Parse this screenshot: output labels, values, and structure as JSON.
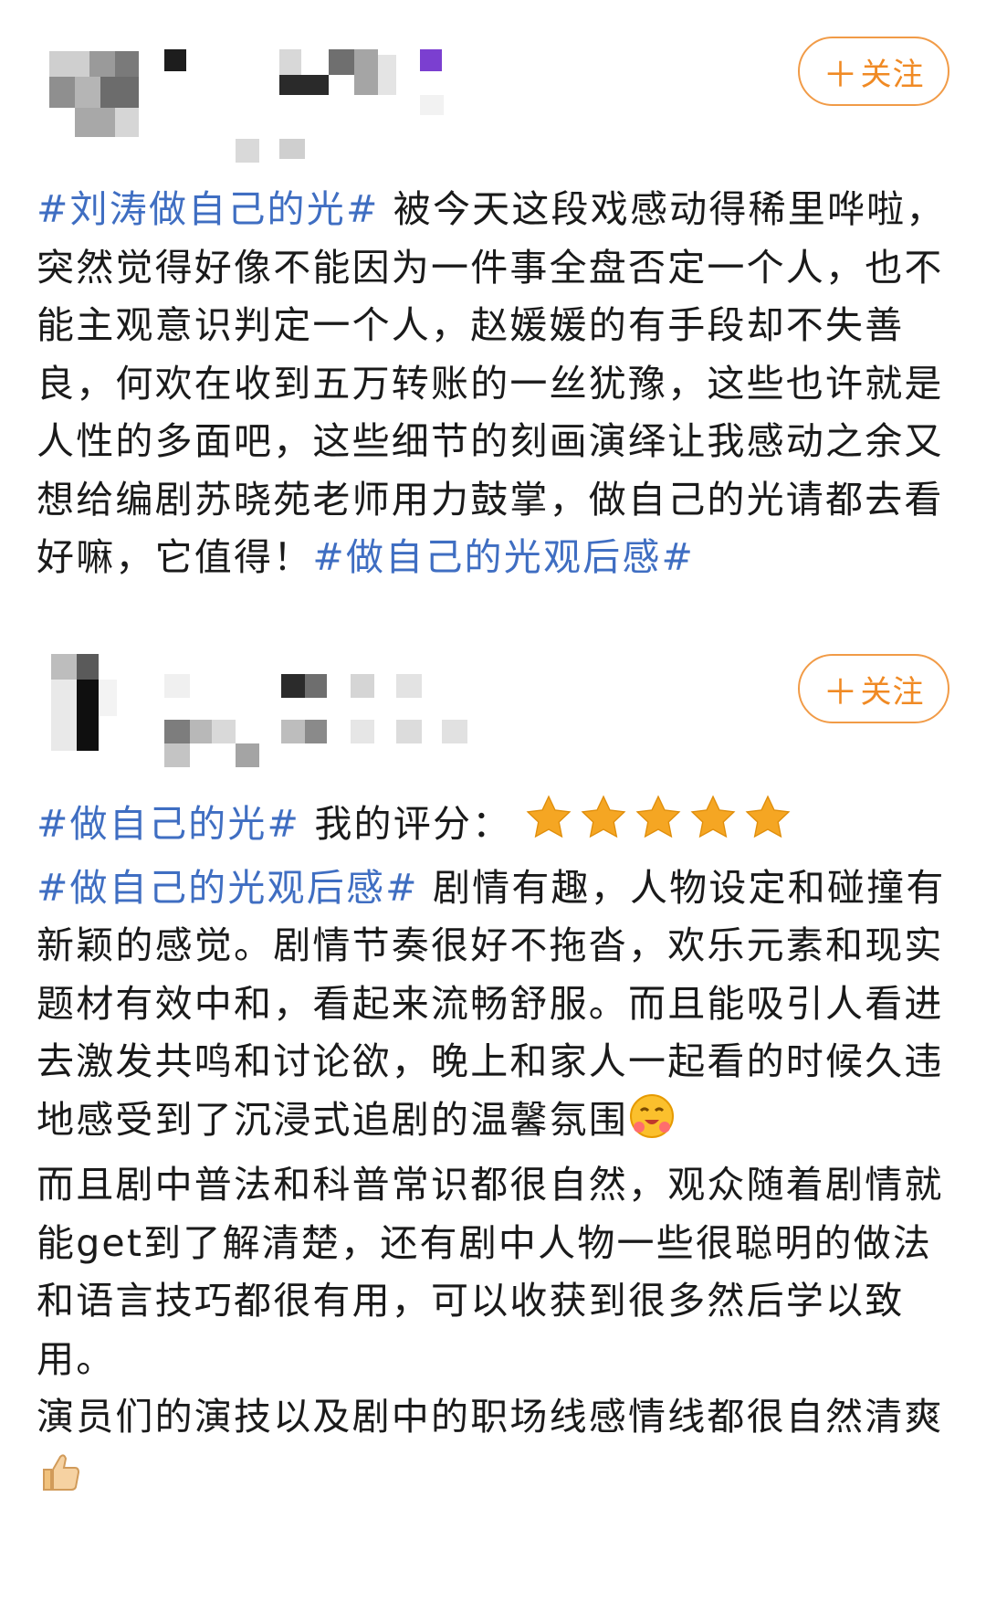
{
  "post1": {
    "follow_label": "关注",
    "follow_icon": "plus-icon",
    "tag1": "#刘涛做自己的光#",
    "text1": " 被今天这段戏感动得稀里哗啦，突然觉得好像不能因为一件事全盘否定一个人，也不能主观意识判定一个人，赵媛媛的有手段却不失善良，何欢在收到五万转账的一丝犹豫，这些也许就是人性的多面吧，这些细节的刻画演绎让我感动之余又想给编剧苏晓苑老师用力鼓掌，做自己的光请都去看好嘛，它值得！",
    "tag2": "#做自己的光观后感#"
  },
  "post2": {
    "follow_label": "关注",
    "follow_icon": "plus-icon",
    "tag1": "#做自己的光#",
    "rating_label": " 我的评分：",
    "rating": 5,
    "rating_max": 5,
    "star_color": "#f5a623",
    "tag2": "#做自己的光观后感#",
    "text1": " 剧情有趣，人物设定和碰撞有新颖的感觉。剧情节奏很好不拖沓，欢乐元素和现实题材有效中和，看起来流畅舒服。而且能吸引人看进去激发共鸣和讨论欲，晚上和家人一起看的时候久违地感受到了沉浸式追剧的温馨氛围",
    "emoji1": "hugging-face-emoji",
    "text2": "而且剧中普法和科普常识都很自然，观众随着剧情就能get到了解清楚，还有剧中人物一些很聪明的做法和语言技巧都很有用，可以收获到很多然后学以致用。",
    "text3": "演员们的演技以及剧中的职场线感情线都很自然清爽",
    "emoji2": "thumbs-up-emoji"
  },
  "colors": {
    "tag": "#3f6ec2",
    "follow": "#f08a24"
  }
}
